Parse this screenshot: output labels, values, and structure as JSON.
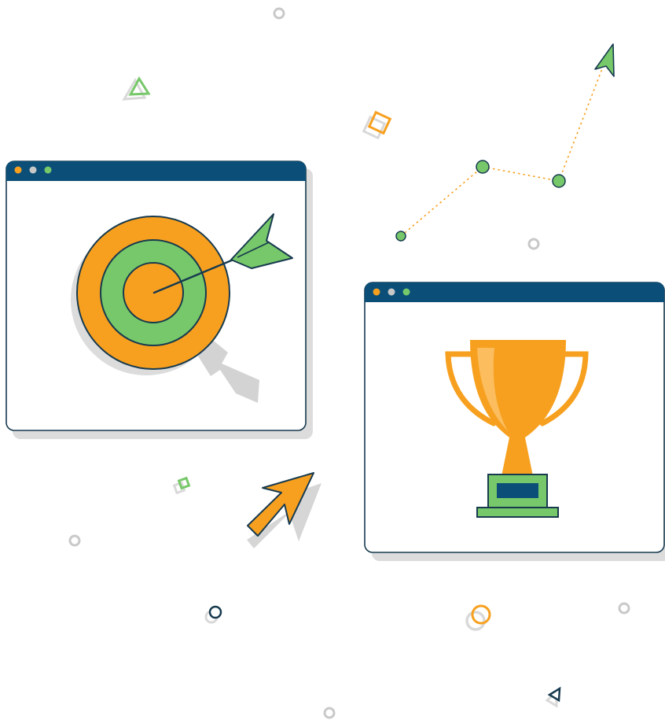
{
  "colors": {
    "navy": "#0b4f78",
    "outline": "#173a4f",
    "orange": "#f7a01f",
    "orange_light": "#fbbd5e",
    "green": "#77c86a",
    "shadow": "#d9d9d9",
    "light_gray": "#c8c8c8",
    "dot_gray": "#c9c9c9",
    "window_bg": "#ffffff"
  },
  "windows": [
    {
      "name": "target-window",
      "controls": [
        "orange",
        "light_gray",
        "green"
      ],
      "content_icon": "dartboard-with-arrow-icon"
    },
    {
      "name": "trophy-window",
      "controls": [
        "orange",
        "light_gray",
        "green"
      ],
      "content_icon": "trophy-icon"
    }
  ],
  "decorations": {
    "trend_line_icon": "growth-path-with-arrow-icon",
    "cursor_icon": "orange-pointer-arrow-icon",
    "confetti_icons": [
      "triangle-icon",
      "square-icon",
      "circle-icon",
      "dot-icon"
    ]
  }
}
